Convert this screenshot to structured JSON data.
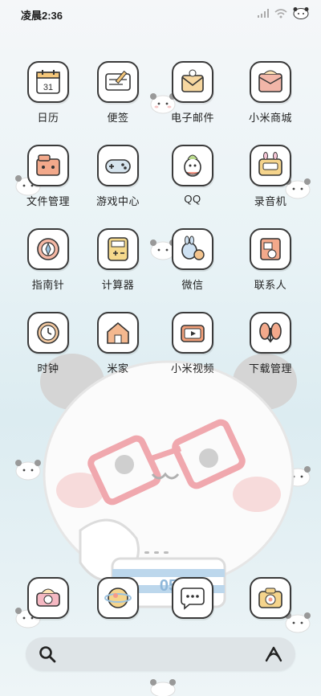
{
  "status_bar": {
    "time": "凌晨2:36",
    "icons": [
      "signal-icon",
      "wifi-icon",
      "panda-battery-icon"
    ]
  },
  "apps": [
    {
      "label": "日历",
      "icon": "calendar-icon",
      "calendar_day": "31"
    },
    {
      "label": "便签",
      "icon": "notes-icon"
    },
    {
      "label": "电子邮件",
      "icon": "email-icon"
    },
    {
      "label": "小米商城",
      "icon": "mi-store-icon"
    },
    {
      "label": "文件管理",
      "icon": "file-manager-icon"
    },
    {
      "label": "游戏中心",
      "icon": "game-center-icon"
    },
    {
      "label": "QQ",
      "icon": "qq-icon"
    },
    {
      "label": "录音机",
      "icon": "recorder-icon"
    },
    {
      "label": "指南针",
      "icon": "compass-icon"
    },
    {
      "label": "计算器",
      "icon": "calculator-icon"
    },
    {
      "label": "微信",
      "icon": "wechat-icon"
    },
    {
      "label": "联系人",
      "icon": "contacts-icon"
    },
    {
      "label": "时钟",
      "icon": "clock-icon"
    },
    {
      "label": "米家",
      "icon": "mijia-icon"
    },
    {
      "label": "小米视频",
      "icon": "mi-video-icon"
    },
    {
      "label": "下载管理",
      "icon": "download-manager-icon"
    }
  ],
  "dock": [
    {
      "icon": "camera-cake-icon"
    },
    {
      "icon": "browser-icon"
    },
    {
      "icon": "messages-icon"
    },
    {
      "icon": "camera-icon"
    }
  ],
  "search": {
    "icon": "search-icon",
    "assist_icon": "assistant-icon"
  },
  "wallpaper": {
    "panda_shirt_text": "05"
  }
}
